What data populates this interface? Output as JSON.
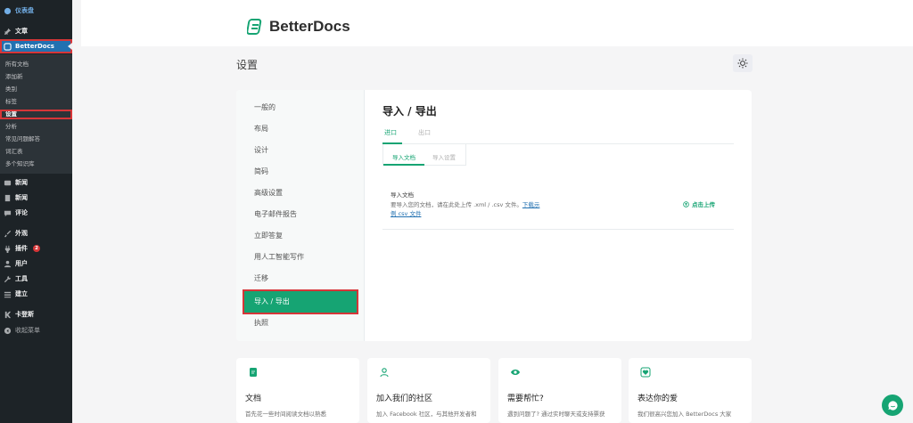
{
  "sidebar": {
    "items": [
      {
        "label": "仪表盘",
        "icon": "dashboard-icon"
      },
      {
        "label": "文章",
        "icon": "pin-icon"
      },
      {
        "label": "BetterDocs",
        "icon": "betterdocs-icon"
      },
      {
        "label": "新闻",
        "icon": "media-icon"
      },
      {
        "label": "新闻",
        "icon": "page-icon"
      },
      {
        "label": "评论",
        "icon": "comment-icon"
      },
      {
        "label": "外观",
        "icon": "brush-icon"
      },
      {
        "label": "插件",
        "icon": "plugin-icon",
        "badge": "2"
      },
      {
        "label": "用户",
        "icon": "user-icon"
      },
      {
        "label": "工具",
        "icon": "wrench-icon"
      },
      {
        "label": "建立",
        "icon": "settings-icon"
      },
      {
        "label": "卡登斯",
        "icon": "kadence-icon"
      },
      {
        "label": "收起菜单",
        "icon": "collapse-icon"
      }
    ],
    "submenu": [
      "所有文档",
      "添加新",
      "类别",
      "标签",
      "设置",
      "分析",
      "常见问题解答",
      "词汇表",
      "多个知识库"
    ]
  },
  "header": {
    "brand": "BetterDocs"
  },
  "page": {
    "title": "设置"
  },
  "settings_nav": [
    "一般的",
    "布局",
    "设计",
    "简码",
    "高级设置",
    "电子邮件报告",
    "立即答复",
    "用人工智能写作",
    "迁移",
    "导入 / 导出",
    "执照"
  ],
  "main": {
    "heading": "导入 / 导出",
    "tabs": [
      "进口",
      "出口"
    ],
    "subtabs": [
      "导入文档",
      "导入设置"
    ],
    "row": {
      "title": "导入文档",
      "desc_line1": "要导入您的文档，请在此处上传 .xml / .csv 文件。",
      "link_part1": "下载示",
      "link_part2": "例 csv 文件",
      "upload": "点击上传"
    }
  },
  "cards": [
    {
      "title": "文档",
      "text": "首先花一些时间阅读文档以熟悉"
    },
    {
      "title": "加入我们的社区",
      "text": "加入 Facebook 社区，与其他开发者和"
    },
    {
      "title": "需要帮忙?",
      "text": "遇到问题了? 通过实时聊天或支持票获"
    },
    {
      "title": "表达你的爱",
      "text": "我们很高兴您加入 BetterDocs 大家"
    }
  ],
  "colors": {
    "accent": "#16a473",
    "wp_sidebar": "#1d2327",
    "wp_active": "#2271b1",
    "highlight": "#d63638"
  }
}
